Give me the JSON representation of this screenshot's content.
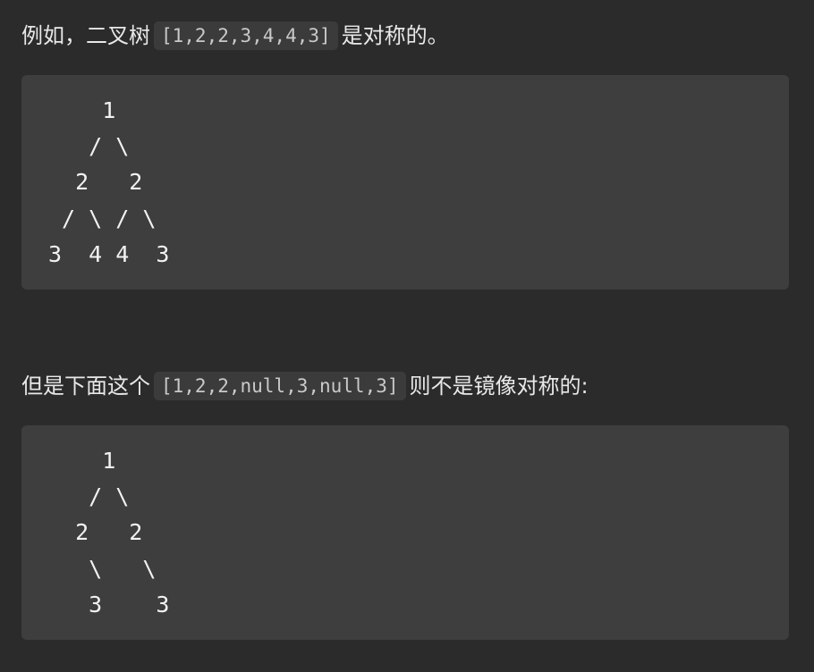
{
  "section1": {
    "text_before": "例如，二叉树",
    "code": "[1,2,2,3,4,4,3]",
    "text_after": "是对称的。",
    "tree_lines": [
      "    1",
      "   / \\",
      "  2   2",
      " / \\ / \\",
      "3  4 4  3"
    ]
  },
  "section2": {
    "text_before": "但是下面这个",
    "code": "[1,2,2,null,3,null,3]",
    "text_after": "则不是镜像对称的:",
    "tree_lines": [
      "    1",
      "   / \\",
      "  2   2",
      "   \\   \\",
      "   3    3"
    ]
  }
}
